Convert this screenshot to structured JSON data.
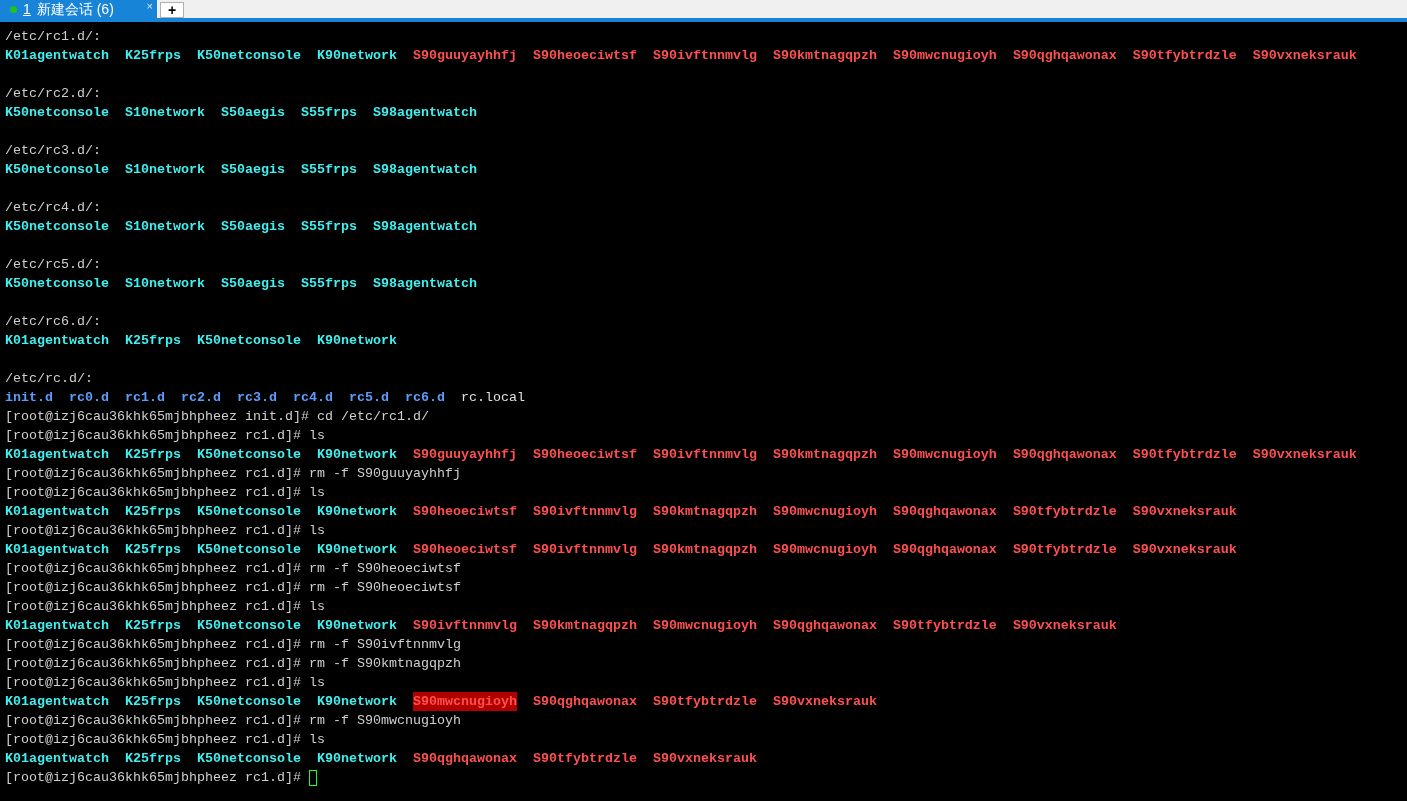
{
  "tabs": [
    {
      "mnemonic": "1",
      "title": "新建会话 (6)",
      "selected": true,
      "close": "×"
    }
  ],
  "new_tab": "+",
  "lines": [
    {
      "kind": "text",
      "text": "/etc/rc1.d/:"
    },
    {
      "kind": "files",
      "files": [
        {
          "name": "K01agentwatch",
          "kind": "exec"
        },
        {
          "name": "K25frps",
          "kind": "exec"
        },
        {
          "name": "K50netconsole",
          "kind": "exec"
        },
        {
          "name": "K90network",
          "kind": "exec"
        },
        {
          "name": "S90guuyayhhfj",
          "kind": "suspect"
        },
        {
          "name": "S90heoeciwtsf",
          "kind": "suspect"
        },
        {
          "name": "S90ivftnnmvlg",
          "kind": "suspect"
        },
        {
          "name": "S90kmtnagqpzh",
          "kind": "suspect"
        },
        {
          "name": "S90mwcnugioyh",
          "kind": "suspect"
        },
        {
          "name": "S90qghqawonax",
          "kind": "suspect"
        },
        {
          "name": "S90tfybtrdzle",
          "kind": "suspect"
        },
        {
          "name": "S90vxneksrauk",
          "kind": "suspect"
        }
      ]
    },
    {
      "kind": "blank"
    },
    {
      "kind": "text",
      "text": "/etc/rc2.d/:"
    },
    {
      "kind": "files",
      "files": [
        {
          "name": "K50netconsole",
          "kind": "exec"
        },
        {
          "name": "S10network",
          "kind": "exec"
        },
        {
          "name": "S50aegis",
          "kind": "exec"
        },
        {
          "name": "S55frps",
          "kind": "exec"
        },
        {
          "name": "S98agentwatch",
          "kind": "exec"
        }
      ]
    },
    {
      "kind": "blank"
    },
    {
      "kind": "text",
      "text": "/etc/rc3.d/:"
    },
    {
      "kind": "files",
      "files": [
        {
          "name": "K50netconsole",
          "kind": "exec"
        },
        {
          "name": "S10network",
          "kind": "exec"
        },
        {
          "name": "S50aegis",
          "kind": "exec"
        },
        {
          "name": "S55frps",
          "kind": "exec"
        },
        {
          "name": "S98agentwatch",
          "kind": "exec"
        }
      ]
    },
    {
      "kind": "blank"
    },
    {
      "kind": "text",
      "text": "/etc/rc4.d/:"
    },
    {
      "kind": "files",
      "files": [
        {
          "name": "K50netconsole",
          "kind": "exec"
        },
        {
          "name": "S10network",
          "kind": "exec"
        },
        {
          "name": "S50aegis",
          "kind": "exec"
        },
        {
          "name": "S55frps",
          "kind": "exec"
        },
        {
          "name": "S98agentwatch",
          "kind": "exec"
        }
      ]
    },
    {
      "kind": "blank"
    },
    {
      "kind": "text",
      "text": "/etc/rc5.d/:"
    },
    {
      "kind": "files",
      "files": [
        {
          "name": "K50netconsole",
          "kind": "exec"
        },
        {
          "name": "S10network",
          "kind": "exec"
        },
        {
          "name": "S50aegis",
          "kind": "exec"
        },
        {
          "name": "S55frps",
          "kind": "exec"
        },
        {
          "name": "S98agentwatch",
          "kind": "exec"
        }
      ]
    },
    {
      "kind": "blank"
    },
    {
      "kind": "text",
      "text": "/etc/rc6.d/:"
    },
    {
      "kind": "files",
      "files": [
        {
          "name": "K01agentwatch",
          "kind": "exec"
        },
        {
          "name": "K25frps",
          "kind": "exec"
        },
        {
          "name": "K50netconsole",
          "kind": "exec"
        },
        {
          "name": "K90network",
          "kind": "exec"
        }
      ]
    },
    {
      "kind": "blank"
    },
    {
      "kind": "text",
      "text": "/etc/rc.d/:"
    },
    {
      "kind": "files",
      "files": [
        {
          "name": "init.d",
          "kind": "dir"
        },
        {
          "name": "rc0.d",
          "kind": "dir"
        },
        {
          "name": "rc1.d",
          "kind": "dir"
        },
        {
          "name": "rc2.d",
          "kind": "dir"
        },
        {
          "name": "rc3.d",
          "kind": "dir"
        },
        {
          "name": "rc4.d",
          "kind": "dir"
        },
        {
          "name": "rc5.d",
          "kind": "dir"
        },
        {
          "name": "rc6.d",
          "kind": "dir"
        },
        {
          "name": "rc.local",
          "kind": "plain"
        }
      ]
    },
    {
      "kind": "text",
      "text": "[root@izj6cau36khk65mjbhpheez init.d]# cd /etc/rc1.d/"
    },
    {
      "kind": "text",
      "text": "[root@izj6cau36khk65mjbhpheez rc1.d]# ls"
    },
    {
      "kind": "files",
      "files": [
        {
          "name": "K01agentwatch",
          "kind": "exec"
        },
        {
          "name": "K25frps",
          "kind": "exec"
        },
        {
          "name": "K50netconsole",
          "kind": "exec"
        },
        {
          "name": "K90network",
          "kind": "exec"
        },
        {
          "name": "S90guuyayhhfj",
          "kind": "suspect"
        },
        {
          "name": "S90heoeciwtsf",
          "kind": "suspect"
        },
        {
          "name": "S90ivftnnmvlg",
          "kind": "suspect"
        },
        {
          "name": "S90kmtnagqpzh",
          "kind": "suspect"
        },
        {
          "name": "S90mwcnugioyh",
          "kind": "suspect"
        },
        {
          "name": "S90qghqawonax",
          "kind": "suspect"
        },
        {
          "name": "S90tfybtrdzle",
          "kind": "suspect"
        },
        {
          "name": "S90vxneksrauk",
          "kind": "suspect"
        }
      ]
    },
    {
      "kind": "text",
      "text": "[root@izj6cau36khk65mjbhpheez rc1.d]# rm -f S90guuyayhhfj"
    },
    {
      "kind": "text",
      "text": "[root@izj6cau36khk65mjbhpheez rc1.d]# ls"
    },
    {
      "kind": "files",
      "files": [
        {
          "name": "K01agentwatch",
          "kind": "exec"
        },
        {
          "name": "K25frps",
          "kind": "exec"
        },
        {
          "name": "K50netconsole",
          "kind": "exec"
        },
        {
          "name": "K90network",
          "kind": "exec"
        },
        {
          "name": "S90heoeciwtsf",
          "kind": "suspect"
        },
        {
          "name": "S90ivftnnmvlg",
          "kind": "suspect"
        },
        {
          "name": "S90kmtnagqpzh",
          "kind": "suspect"
        },
        {
          "name": "S90mwcnugioyh",
          "kind": "suspect"
        },
        {
          "name": "S90qghqawonax",
          "kind": "suspect"
        },
        {
          "name": "S90tfybtrdzle",
          "kind": "suspect"
        },
        {
          "name": "S90vxneksrauk",
          "kind": "suspect"
        }
      ]
    },
    {
      "kind": "text",
      "text": "[root@izj6cau36khk65mjbhpheez rc1.d]# ls"
    },
    {
      "kind": "files",
      "files": [
        {
          "name": "K01agentwatch",
          "kind": "exec"
        },
        {
          "name": "K25frps",
          "kind": "exec"
        },
        {
          "name": "K50netconsole",
          "kind": "exec"
        },
        {
          "name": "K90network",
          "kind": "exec"
        },
        {
          "name": "S90heoeciwtsf",
          "kind": "suspect"
        },
        {
          "name": "S90ivftnnmvlg",
          "kind": "suspect"
        },
        {
          "name": "S90kmtnagqpzh",
          "kind": "suspect"
        },
        {
          "name": "S90mwcnugioyh",
          "kind": "suspect"
        },
        {
          "name": "S90qghqawonax",
          "kind": "suspect"
        },
        {
          "name": "S90tfybtrdzle",
          "kind": "suspect"
        },
        {
          "name": "S90vxneksrauk",
          "kind": "suspect"
        }
      ]
    },
    {
      "kind": "text",
      "text": "[root@izj6cau36khk65mjbhpheez rc1.d]# rm -f S90heoeciwtsf"
    },
    {
      "kind": "text",
      "text": "[root@izj6cau36khk65mjbhpheez rc1.d]# rm -f S90heoeciwtsf"
    },
    {
      "kind": "text",
      "text": "[root@izj6cau36khk65mjbhpheez rc1.d]# ls"
    },
    {
      "kind": "files",
      "files": [
        {
          "name": "K01agentwatch",
          "kind": "exec"
        },
        {
          "name": "K25frps",
          "kind": "exec"
        },
        {
          "name": "K50netconsole",
          "kind": "exec"
        },
        {
          "name": "K90network",
          "kind": "exec"
        },
        {
          "name": "S90ivftnnmvlg",
          "kind": "suspect"
        },
        {
          "name": "S90kmtnagqpzh",
          "kind": "suspect"
        },
        {
          "name": "S90mwcnugioyh",
          "kind": "suspect"
        },
        {
          "name": "S90qghqawonax",
          "kind": "suspect"
        },
        {
          "name": "S90tfybtrdzle",
          "kind": "suspect"
        },
        {
          "name": "S90vxneksrauk",
          "kind": "suspect"
        }
      ]
    },
    {
      "kind": "text",
      "text": "[root@izj6cau36khk65mjbhpheez rc1.d]# rm -f S90ivftnnmvlg"
    },
    {
      "kind": "text",
      "text": "[root@izj6cau36khk65mjbhpheez rc1.d]# rm -f S90kmtnagqpzh"
    },
    {
      "kind": "text",
      "text": "[root@izj6cau36khk65mjbhpheez rc1.d]# ls"
    },
    {
      "kind": "files",
      "files": [
        {
          "name": "K01agentwatch",
          "kind": "exec",
          "selected": false
        },
        {
          "name": "K25frps",
          "kind": "exec",
          "selected": false
        },
        {
          "name": "K50netconsole",
          "kind": "exec",
          "selected": false
        },
        {
          "name": "K90network",
          "kind": "exec",
          "selected": false
        },
        {
          "name": "S90mwcnugioyh",
          "kind": "suspect",
          "selected": true
        },
        {
          "name": "S90qghqawonax",
          "kind": "suspect",
          "selected": false
        },
        {
          "name": "S90tfybtrdzle",
          "kind": "suspect",
          "selected": false
        },
        {
          "name": "S90vxneksrauk",
          "kind": "suspect",
          "selected": false
        }
      ]
    },
    {
      "kind": "text",
      "text": "[root@izj6cau36khk65mjbhpheez rc1.d]# rm -f S90mwcnugioyh"
    },
    {
      "kind": "text",
      "text": "[root@izj6cau36khk65mjbhpheez rc1.d]# ls"
    },
    {
      "kind": "files",
      "files": [
        {
          "name": "K01agentwatch",
          "kind": "exec"
        },
        {
          "name": "K25frps",
          "kind": "exec"
        },
        {
          "name": "K50netconsole",
          "kind": "exec"
        },
        {
          "name": "K90network",
          "kind": "exec"
        },
        {
          "name": "S90qghqawonax",
          "kind": "suspect"
        },
        {
          "name": "S90tfybtrdzle",
          "kind": "suspect"
        },
        {
          "name": "S90vxneksrauk",
          "kind": "suspect"
        }
      ]
    },
    {
      "kind": "prompt",
      "text": "[root@izj6cau36khk65mjbhpheez rc1.d]#",
      "cursor": true
    }
  ]
}
